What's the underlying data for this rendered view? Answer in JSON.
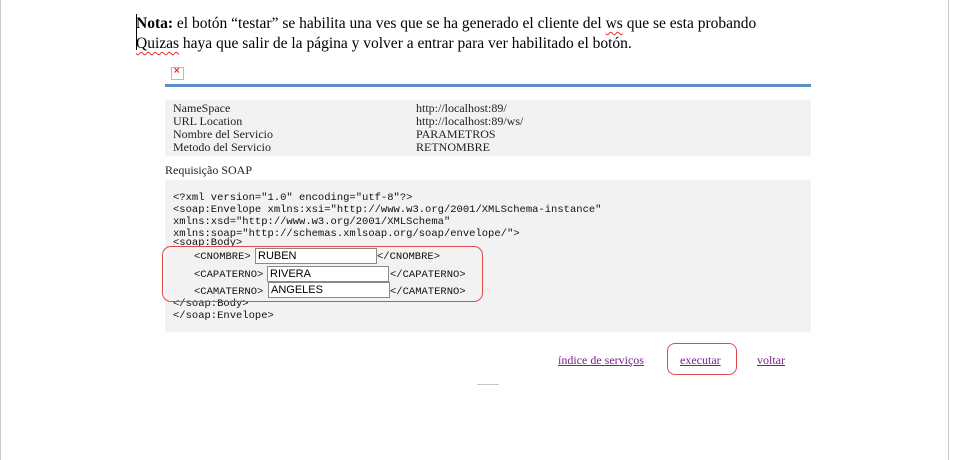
{
  "note": {
    "bold_label": "Nota:",
    "line1_part1": " el botón “testar” se habilita una ves que se ha generado el cliente del ",
    "line1_ws": "ws",
    "line1_part2": " que se esta probando",
    "line2_word": "Quizas",
    "line2_rest": " haya que salir de la página y volver a entrar para ver habilitado el botón."
  },
  "broken_image_glyph": "×",
  "info": [
    {
      "label": "NameSpace",
      "value": "http://localhost:89/"
    },
    {
      "label": "URL Location",
      "value": "http://localhost:89/ws/"
    },
    {
      "label": "Nombre del Servicio",
      "value": "PARAMETROS"
    },
    {
      "label": "Metodo del Servicio",
      "value": "RETNOMBRE"
    }
  ],
  "request_label": "Requisição SOAP",
  "soap": {
    "line1": "<?xml version=\"1.0\" encoding=\"utf-8\"?>",
    "line2": "<soap:Envelope xmlns:xsi=\"http://www.w3.org/2001/XMLSchema-instance\"",
    "line3": "xmlns:xsd=\"http://www.w3.org/2001/XMLSchema\"",
    "line4": "xmlns:soap=\"http://schemas.xmlsoap.org/soap/envelope/\">",
    "line5": "<soap:Body>",
    "nombre_open": "<CNOMBRE>",
    "nombre_close": "</CNOMBRE>",
    "paterno_open": "<CAPATERNO>",
    "paterno_close": "</CAPATERNO>",
    "materno_open": "<CAMATERNO>",
    "materno_close": "</CAMATERNO>",
    "body_close": "</soap:Body>",
    "envelope_close": "</soap:Envelope>"
  },
  "fields": {
    "nombre": "RUBEN",
    "paterno": "RIVERA",
    "materno": "ANGELES"
  },
  "links": {
    "index": "índice de serviços",
    "execute": "executar",
    "back": "voltar"
  },
  "colors": {
    "accent_bar": "#5b8fc8",
    "highlight": "#e24a4a",
    "link": "#7a1f8a"
  }
}
